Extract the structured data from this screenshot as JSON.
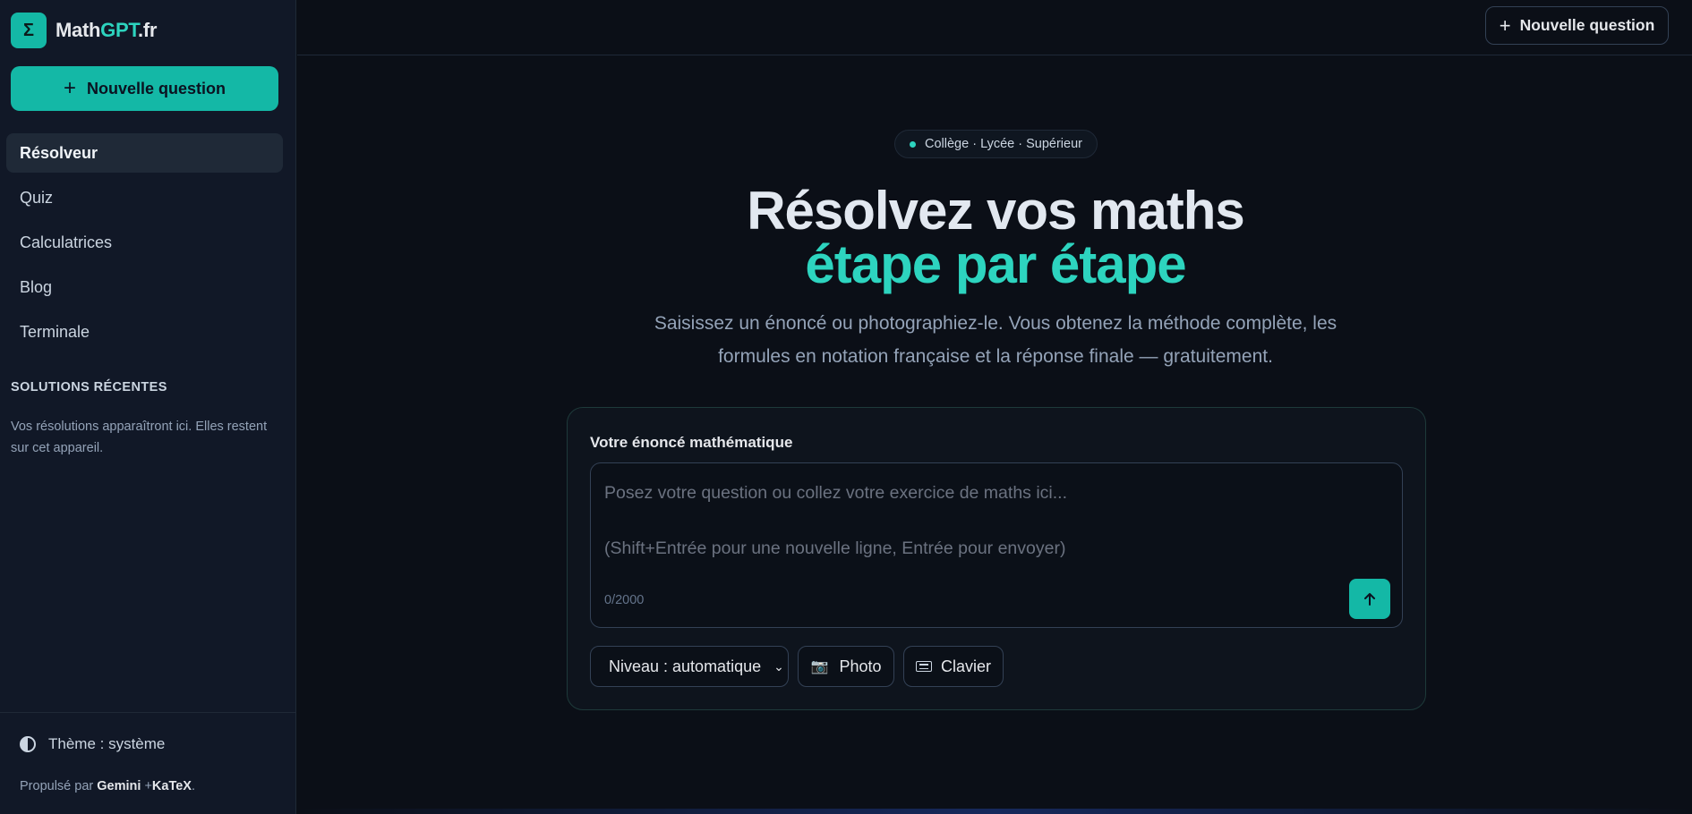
{
  "brand": {
    "logo_symbol": "Σ",
    "name_part1": "Math",
    "name_part2": "GPT",
    "name_part3": ".fr",
    "accent_color": "#2dd4bf"
  },
  "sidebar": {
    "new_question_label": "Nouvelle question",
    "items": [
      {
        "label": "Résolveur",
        "active": true
      },
      {
        "label": "Quiz",
        "active": false
      },
      {
        "label": "Calculatrices",
        "active": false
      },
      {
        "label": "Blog",
        "active": false
      },
      {
        "label": "Terminale",
        "active": false
      }
    ],
    "recent_title": "SOLUTIONS RÉCENTES",
    "recent_empty_text": "Vos résolutions apparaîtront ici. Elles restent sur cet appareil.",
    "theme_label": "Thème : système",
    "powered_prefix": "Propulsé par",
    "powered_gemini": "Gemini",
    "powered_plus": "+",
    "powered_katex": "KaTeX",
    "powered_suffix": "."
  },
  "topbar": {
    "new_question_label": "Nouvelle question"
  },
  "hero": {
    "badge": "Collège · Lycée · Supérieur",
    "title_line1": "Résolvez vos maths",
    "title_line2": "étape par étape",
    "subtitle": "Saisissez un énoncé ou photographiez-le. Vous obtenez la méthode complète, les formules en notation française et la réponse finale — gratuitement."
  },
  "card": {
    "label": "Votre énoncé mathématique",
    "placeholder_line1": "Posez votre question ou collez votre exercice de maths ici...",
    "placeholder_line2": "(Shift+Entrée pour une nouvelle ligne, Entrée pour envoyer)",
    "counter": "0/2000",
    "level_select": "Niveau : automatique",
    "photo_label": "Photo",
    "keyboard_label": "Clavier"
  }
}
